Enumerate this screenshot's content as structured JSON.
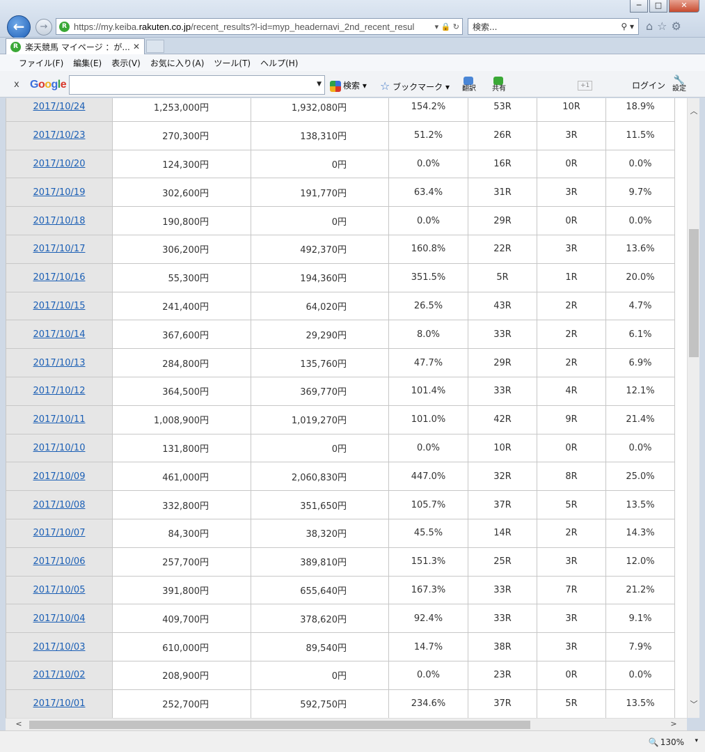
{
  "window": {
    "minimize": "─",
    "maximize": "□",
    "close": "✕"
  },
  "nav": {
    "back_icon": "←",
    "forward_icon": "→"
  },
  "address": {
    "scheme": "https://my.keiba.",
    "host": "rakuten.co.jp",
    "path": "/recent_results?l-id=myp_headernavi_2nd_recent_resul",
    "icons": "▾ 🔒 ↻"
  },
  "search": {
    "placeholder": "検索...",
    "icon": "⚲ ▾"
  },
  "tab": {
    "logo": "R",
    "title": "楽天競馬 マイページ ：が...",
    "close": "✕"
  },
  "menu": [
    "ファイル(F)",
    "編集(E)",
    "表示(V)",
    "お気に入り(A)",
    "ツール(T)",
    "ヘルプ(H)"
  ],
  "google_toolbar": {
    "close": "x",
    "search_label": "検索 ▾",
    "bookmark_label": "ブックマーク ▾",
    "translate_label": "翻訳",
    "share_label": "共有",
    "plus_one": "+1",
    "login_label": "ログイン",
    "settings_label": "設定"
  },
  "rows": [
    {
      "date": "2017/10/24",
      "bet": "1,253,000円",
      "payout": "1,932,080円",
      "rate": "154.2%",
      "races": "53R",
      "hits": "10R",
      "hit_rate": "18.9%"
    },
    {
      "date": "2017/10/23",
      "bet": "270,300円",
      "payout": "138,310円",
      "rate": "51.2%",
      "races": "26R",
      "hits": "3R",
      "hit_rate": "11.5%"
    },
    {
      "date": "2017/10/20",
      "bet": "124,300円",
      "payout": "0円",
      "rate": "0.0%",
      "races": "16R",
      "hits": "0R",
      "hit_rate": "0.0%"
    },
    {
      "date": "2017/10/19",
      "bet": "302,600円",
      "payout": "191,770円",
      "rate": "63.4%",
      "races": "31R",
      "hits": "3R",
      "hit_rate": "9.7%"
    },
    {
      "date": "2017/10/18",
      "bet": "190,800円",
      "payout": "0円",
      "rate": "0.0%",
      "races": "29R",
      "hits": "0R",
      "hit_rate": "0.0%"
    },
    {
      "date": "2017/10/17",
      "bet": "306,200円",
      "payout": "492,370円",
      "rate": "160.8%",
      "races": "22R",
      "hits": "3R",
      "hit_rate": "13.6%"
    },
    {
      "date": "2017/10/16",
      "bet": "55,300円",
      "payout": "194,360円",
      "rate": "351.5%",
      "races": "5R",
      "hits": "1R",
      "hit_rate": "20.0%"
    },
    {
      "date": "2017/10/15",
      "bet": "241,400円",
      "payout": "64,020円",
      "rate": "26.5%",
      "races": "43R",
      "hits": "2R",
      "hit_rate": "4.7%"
    },
    {
      "date": "2017/10/14",
      "bet": "367,600円",
      "payout": "29,290円",
      "rate": "8.0%",
      "races": "33R",
      "hits": "2R",
      "hit_rate": "6.1%"
    },
    {
      "date": "2017/10/13",
      "bet": "284,800円",
      "payout": "135,760円",
      "rate": "47.7%",
      "races": "29R",
      "hits": "2R",
      "hit_rate": "6.9%"
    },
    {
      "date": "2017/10/12",
      "bet": "364,500円",
      "payout": "369,770円",
      "rate": "101.4%",
      "races": "33R",
      "hits": "4R",
      "hit_rate": "12.1%"
    },
    {
      "date": "2017/10/11",
      "bet": "1,008,900円",
      "payout": "1,019,270円",
      "rate": "101.0%",
      "races": "42R",
      "hits": "9R",
      "hit_rate": "21.4%"
    },
    {
      "date": "2017/10/10",
      "bet": "131,800円",
      "payout": "0円",
      "rate": "0.0%",
      "races": "10R",
      "hits": "0R",
      "hit_rate": "0.0%"
    },
    {
      "date": "2017/10/09",
      "bet": "461,000円",
      "payout": "2,060,830円",
      "rate": "447.0%",
      "races": "32R",
      "hits": "8R",
      "hit_rate": "25.0%"
    },
    {
      "date": "2017/10/08",
      "bet": "332,800円",
      "payout": "351,650円",
      "rate": "105.7%",
      "races": "37R",
      "hits": "5R",
      "hit_rate": "13.5%"
    },
    {
      "date": "2017/10/07",
      "bet": "84,300円",
      "payout": "38,320円",
      "rate": "45.5%",
      "races": "14R",
      "hits": "2R",
      "hit_rate": "14.3%"
    },
    {
      "date": "2017/10/06",
      "bet": "257,700円",
      "payout": "389,810円",
      "rate": "151.3%",
      "races": "25R",
      "hits": "3R",
      "hit_rate": "12.0%"
    },
    {
      "date": "2017/10/05",
      "bet": "391,800円",
      "payout": "655,640円",
      "rate": "167.3%",
      "races": "33R",
      "hits": "7R",
      "hit_rate": "21.2%"
    },
    {
      "date": "2017/10/04",
      "bet": "409,700円",
      "payout": "378,620円",
      "rate": "92.4%",
      "races": "33R",
      "hits": "3R",
      "hit_rate": "9.1%"
    },
    {
      "date": "2017/10/03",
      "bet": "610,000円",
      "payout": "89,540円",
      "rate": "14.7%",
      "races": "38R",
      "hits": "3R",
      "hit_rate": "7.9%"
    },
    {
      "date": "2017/10/02",
      "bet": "208,900円",
      "payout": "0円",
      "rate": "0.0%",
      "races": "23R",
      "hits": "0R",
      "hit_rate": "0.0%"
    },
    {
      "date": "2017/10/01",
      "bet": "252,700円",
      "payout": "592,750円",
      "rate": "234.6%",
      "races": "37R",
      "hits": "5R",
      "hit_rate": "13.5%"
    }
  ],
  "scroll": {
    "up": "︿",
    "down": "﹀",
    "left": "<",
    "right": ">"
  },
  "status": {
    "zoom": "130%",
    "zoom_icon": "🔍",
    "zoom_arrow": "▾"
  }
}
